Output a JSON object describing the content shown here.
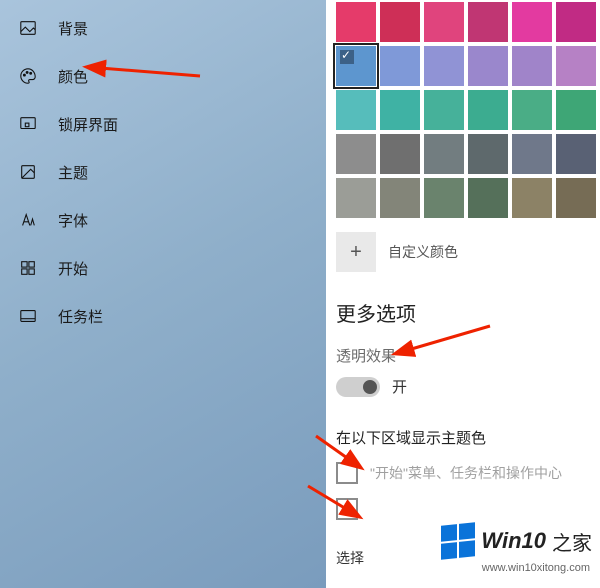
{
  "sidebar": {
    "items": [
      {
        "label": "背景",
        "icon": "image-icon"
      },
      {
        "label": "颜色",
        "icon": "palette-icon"
      },
      {
        "label": "锁屏界面",
        "icon": "lockscreen-icon"
      },
      {
        "label": "主题",
        "icon": "theme-icon"
      },
      {
        "label": "字体",
        "icon": "font-icon"
      },
      {
        "label": "开始",
        "icon": "start-icon"
      },
      {
        "label": "任务栏",
        "icon": "taskbar-icon"
      }
    ]
  },
  "palette": {
    "rows": [
      [
        "#e53b6a",
        "#ce2f57",
        "#e0447d",
        "#c03673",
        "#e33aa0",
        "#c12b84"
      ],
      [
        "#5d96cf",
        "#7f99d8",
        "#9093d5",
        "#9a87cc",
        "#a084c9",
        "#b681c5"
      ],
      [
        "#56bdbb",
        "#3fb2a4",
        "#46b19a",
        "#3cac90",
        "#4aad86",
        "#3ea676"
      ],
      [
        "#8d8d8d",
        "#6f6f6f",
        "#727d80",
        "#5e696c",
        "#6f788a",
        "#596174"
      ],
      [
        "#9b9d97",
        "#838579",
        "#6a836d",
        "#55705a",
        "#8c8266",
        "#766c55"
      ]
    ],
    "selected": {
      "row": 1,
      "col": 0
    }
  },
  "custom_color": {
    "add": "+",
    "label": "自定义颜色"
  },
  "more_options": {
    "title": "更多选项",
    "transparency": {
      "label": "透明效果",
      "toggle_text": "开",
      "state": "on"
    }
  },
  "accent_areas": {
    "title": "在以下区域显示主题色",
    "checks": [
      {
        "label": "\"开始\"菜单、任务栏和操作中心"
      },
      {
        "label": ""
      }
    ],
    "footer": "选择"
  },
  "watermark": {
    "brand": "Win10",
    "suffix": "之家",
    "url": "www.win10xitong.com"
  }
}
